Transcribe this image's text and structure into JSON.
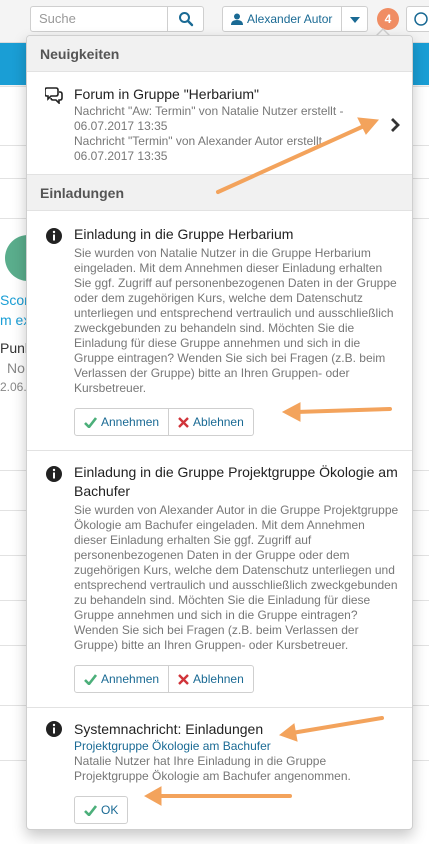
{
  "header": {
    "search_placeholder": "Suche",
    "user_name": "Alexander Autor",
    "notification_count": "4"
  },
  "background": {
    "text_1": "Scor",
    "text_2": "m ex",
    "text_3": "Punk",
    "text_4": "No",
    "text_5": "2.06."
  },
  "news": {
    "header": "Neuigkeiten",
    "title": "Forum in Gruppe \"Herbarium\"",
    "entries": [
      "Nachricht \"Aw: Termin\" von Natalie Nutzer erstellt - 06.07.2017 13:35",
      "Nachricht \"Termin\" von Alexander Autor erstellt - 06.07.2017 13:35"
    ]
  },
  "invitations": {
    "header": "Einladungen",
    "items": [
      {
        "title": "Einladung in die Gruppe Herbarium",
        "body": "Sie wurden von Natalie Nutzer in die Gruppe Herbarium eingeladen. Mit dem Annehmen dieser Einladung erhalten Sie ggf. Zugriff auf personenbezogenen Daten in der Gruppe oder dem zugehörigen Kurs, welche dem Datenschutz unterliegen und entsprechend vertraulich und ausschließlich zweckgebunden zu behandeln sind. Möchten Sie die Einladung für diese Gruppe annehmen und sich in die Gruppe eintragen? Wenden Sie sich bei Fragen (z.B. beim Verlassen der Gruppe) bitte an Ihren Gruppen- oder Kursbetreuer.",
        "accept_label": "Annehmen",
        "decline_label": "Ablehnen"
      },
      {
        "title": "Einladung in die Gruppe Projektgruppe Ökologie am Bachufer",
        "body": "Sie wurden von Alexander Autor in die Gruppe Projektgruppe Ökologie am Bachufer eingeladen. Mit dem Annehmen dieser Einladung erhalten Sie ggf. Zugriff auf personenbezogenen Daten in der Gruppe oder dem zugehörigen Kurs, welche dem Datenschutz unterliegen und entsprechend vertraulich und ausschließlich zweckgebunden zu behandeln sind. Möchten Sie die Einladung für diese Gruppe annehmen und sich in die Gruppe eintragen? Wenden Sie sich bei Fragen (z.B. beim Verlassen der Gruppe) bitte an Ihren Gruppen- oder Kursbetreuer.",
        "accept_label": "Annehmen",
        "decline_label": "Ablehnen"
      }
    ],
    "system": {
      "title": "Systemnachricht: Einladungen",
      "link": "Projektgruppe Ökologie am Bachufer",
      "body": "Natalie Nutzer hat Ihre Einladung in die Gruppe Projektgruppe Ökologie am Bachufer angenommen.",
      "ok_label": "OK"
    }
  },
  "colors": {
    "accent_blue": "#1a6a94",
    "teal_bar": "#1a9ed5",
    "badge_orange": "#f08d63",
    "check_green": "#4caf7a",
    "cross_red": "#d0343a",
    "annotation_arrow": "#f3a35c"
  }
}
